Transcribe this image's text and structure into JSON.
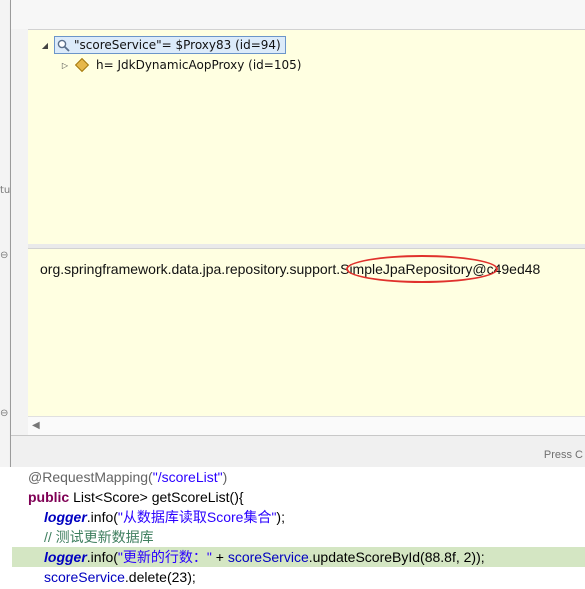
{
  "inspect_popup": {
    "tree": {
      "root_label": "\"scoreService\"= $Proxy83  (id=94)",
      "child_label": "h= JdkDynamicAopProxy  (id=105)"
    },
    "detail_text": "org.springframework.data.jpa.repository.support.SimpleJpaRepository@c49ed48",
    "status_text": "Press C",
    "highlight_color": "#e0312c"
  },
  "editor": {
    "gutter_marks": [
      "tu",
      "⊖",
      "⊖",
      "⊖"
    ],
    "lines": [
      {
        "tokens": [
          {
            "t": "@RequestMapping(",
            "c": "anno"
          },
          {
            "t": "\"/scoreList\"",
            "c": "str"
          },
          {
            "t": ")",
            "c": "anno"
          }
        ]
      },
      {
        "tokens": [
          {
            "t": "public",
            "c": "kw"
          },
          {
            "t": " List<Score> getScoreList(){",
            "c": "plain"
          }
        ]
      },
      {
        "tokens": [
          {
            "t": "logger",
            "c": "field-it"
          },
          {
            "t": ".info(",
            "c": "plain"
          },
          {
            "t": "\"从数据库读取Score集合\"",
            "c": "str"
          },
          {
            "t": ");",
            "c": "plain"
          }
        ]
      },
      {
        "tokens": [
          {
            "t": "// 测试更新数据库",
            "c": "comment"
          }
        ]
      },
      {
        "tokens": [
          {
            "t": "logger",
            "c": "field-it"
          },
          {
            "t": ".info(",
            "c": "plain"
          },
          {
            "t": "\"更新的行数：\"",
            "c": "str"
          },
          {
            "t": " + ",
            "c": "plain"
          },
          {
            "t": "scoreService",
            "c": "field"
          },
          {
            "t": ".updateScoreById(88.8f, 2));",
            "c": "plain"
          }
        ]
      },
      {
        "tokens": [
          {
            "t": "scoreService",
            "c": "field"
          },
          {
            "t": ".delete(23);",
            "c": "plain"
          }
        ]
      }
    ]
  }
}
